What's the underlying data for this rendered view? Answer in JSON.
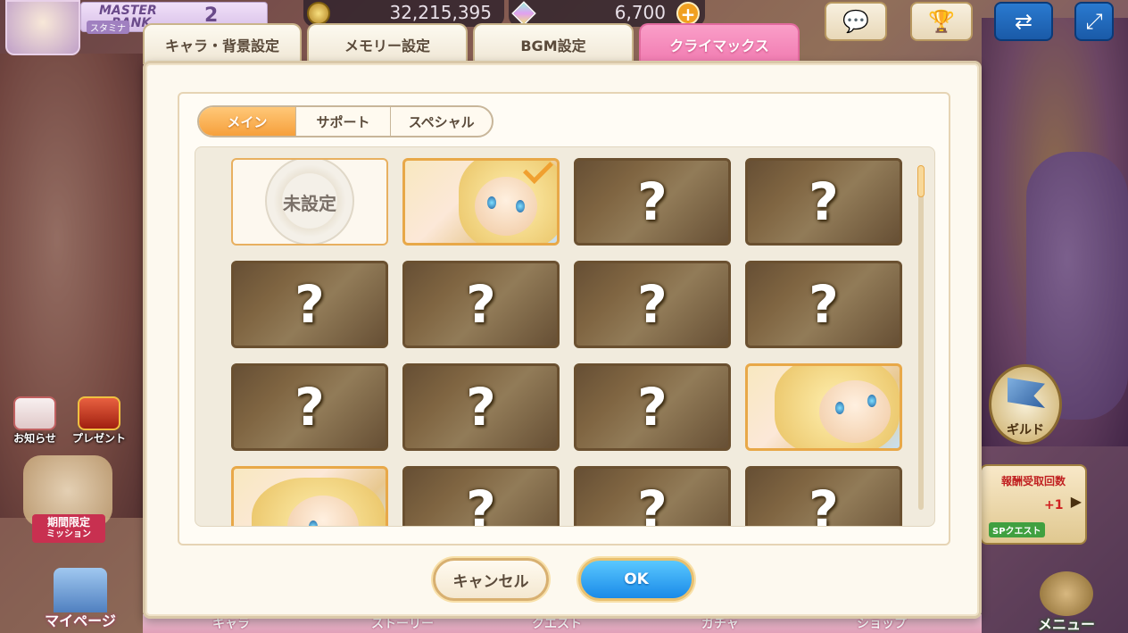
{
  "header": {
    "rank_label_line1": "MASTER",
    "rank_label_line2": "RANK",
    "rank_value": "2",
    "stamina_label": "スタミナ",
    "coins": "32,215,395",
    "gems": "6,700",
    "gem_plus": "+"
  },
  "side_left": {
    "notice": "お知らせ",
    "present": "プレゼント",
    "limited_mission_line1": "期間限定",
    "limited_mission_line2": "ミッション",
    "my_page": "マイページ"
  },
  "side_right": {
    "guild": "ギルド",
    "sp_quest_top": "報酬受取回数",
    "sp_quest_plus": "+1",
    "sp_quest_label": "SPクエスト",
    "menu": "メニュー"
  },
  "bottom_nav": [
    "キャラ",
    "ストーリー",
    "クエスト",
    "ガチャ",
    "ショップ"
  ],
  "dialog": {
    "tabs": [
      {
        "label": "キャラ・背景設定",
        "active": false
      },
      {
        "label": "メモリー設定",
        "active": false
      },
      {
        "label": "BGM設定",
        "active": false
      },
      {
        "label": "クライマックス",
        "active": true
      }
    ],
    "subtabs": [
      {
        "label": "メイン",
        "active": true
      },
      {
        "label": "サポート",
        "active": false
      },
      {
        "label": "スペシャル",
        "active": false
      }
    ],
    "tiles": [
      {
        "state": "unset",
        "label": "未設定"
      },
      {
        "state": "selected",
        "label": ""
      },
      {
        "state": "locked",
        "label": "?"
      },
      {
        "state": "locked",
        "label": "?"
      },
      {
        "state": "locked",
        "label": "?"
      },
      {
        "state": "locked",
        "label": "?"
      },
      {
        "state": "locked",
        "label": "?"
      },
      {
        "state": "locked",
        "label": "?"
      },
      {
        "state": "locked",
        "label": "?"
      },
      {
        "state": "locked",
        "label": "?"
      },
      {
        "state": "locked",
        "label": "?"
      },
      {
        "state": "unlocked",
        "label": ""
      },
      {
        "state": "unlocked",
        "label": ""
      },
      {
        "state": "locked",
        "label": "?"
      },
      {
        "state": "locked",
        "label": "?"
      },
      {
        "state": "locked",
        "label": "?"
      }
    ],
    "cancel_label": "キャンセル",
    "ok_label": "OK"
  },
  "colors": {
    "active_tab": "#f07ab0",
    "active_subtab": "#f6a03c",
    "ok_button": "#1a8ae8",
    "dialog_bg": "#fdf9ef"
  }
}
